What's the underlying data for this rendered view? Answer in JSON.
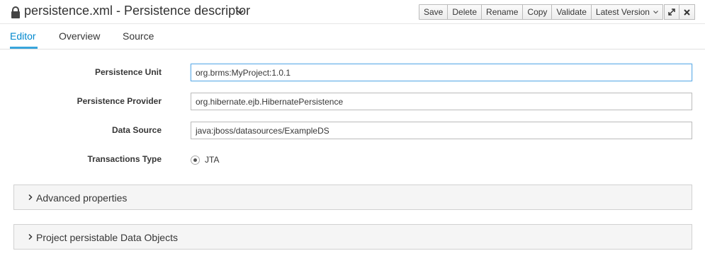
{
  "header": {
    "title": "persistence.xml - Persistence descriptor",
    "buttons": {
      "save": "Save",
      "delete": "Delete",
      "rename": "Rename",
      "copy": "Copy",
      "validate": "Validate",
      "latest_version": "Latest Version"
    },
    "icons": [
      "lock-icon",
      "chevron-down-icon",
      "expand-icon",
      "close-icon"
    ]
  },
  "tabs": [
    {
      "label": "Editor",
      "active": true
    },
    {
      "label": "Overview",
      "active": false
    },
    {
      "label": "Source",
      "active": false
    }
  ],
  "form": {
    "persistence_unit": {
      "label": "Persistence Unit",
      "value": "org.brms:MyProject:1.0.1"
    },
    "persistence_provider": {
      "label": "Persistence Provider",
      "value": "org.hibernate.ejb.HibernatePersistence"
    },
    "data_source": {
      "label": "Data Source",
      "value": "java:jboss/datasources/ExampleDS"
    },
    "transactions_type": {
      "label": "Transactions Type",
      "option": "JTA",
      "selected": true
    }
  },
  "panels": [
    {
      "title": "Advanced properties",
      "expanded": false
    },
    {
      "title": "Project persistable Data Objects",
      "expanded": false
    }
  ],
  "colors": {
    "accent": "#0088ce",
    "border": "#bbbbbb",
    "panel_bg": "#f5f5f5"
  }
}
